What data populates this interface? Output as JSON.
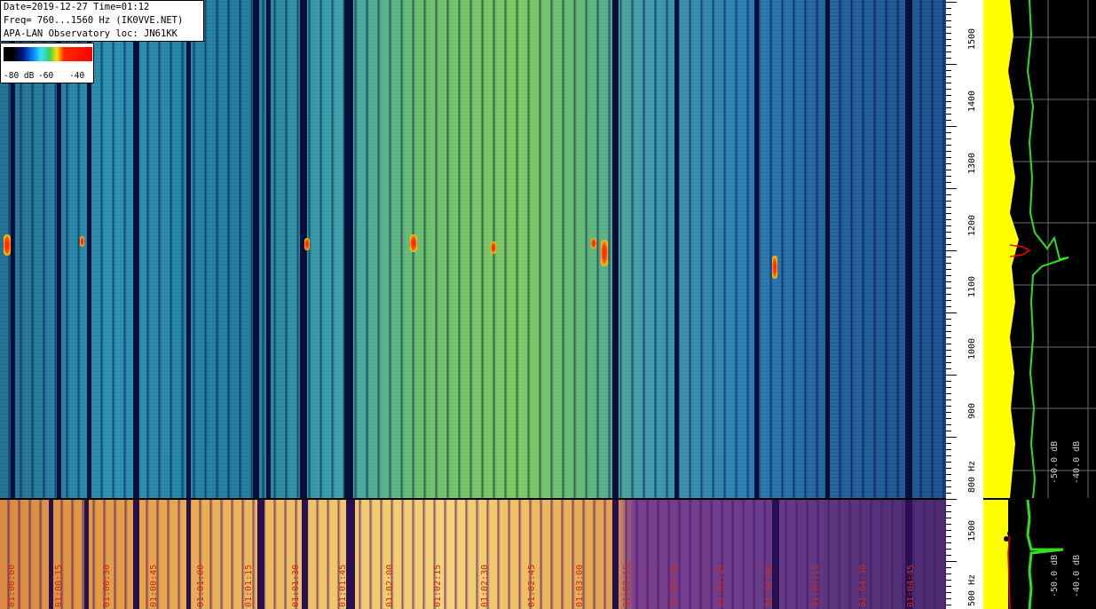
{
  "info": {
    "line1": "Date=2019-12-27 Time=01:12",
    "line2": "Freq= 760...1560 Hz (IK0VVE.NET)",
    "line3": "APA-LAN Observatory loc: JN61KK"
  },
  "colorbar": {
    "labels": [
      "-80 dB",
      "-60",
      "-40"
    ]
  },
  "freq_axis": {
    "ticks_upper": [
      "1500",
      "1400",
      "1300",
      "1200",
      "1100",
      "1000",
      "900",
      "800 Hz"
    ],
    "ticks_lower": [
      "1500",
      "500 Hz"
    ]
  },
  "spectrum": {
    "db_labels_upper": [
      "-50.0 dB",
      "-40.0 dB"
    ],
    "db_labels_lower": [
      "-50.0 dB",
      "-40.0 dB"
    ]
  },
  "time_labels": [
    "01:00:00",
    "01:00:15",
    "01:00:30",
    "01:00:45",
    "01:01:00",
    "01:01:15",
    "01:01:30",
    "01:01:45",
    "01:02:00",
    "01:02:15",
    "01:02:30",
    "01:02:45",
    "01:03:00",
    "01:03:15",
    "01:03:30",
    "01:03:45",
    "01:04:00",
    "01:04:15",
    "01:04:30",
    "01:04:45"
  ],
  "colors": {
    "background": "#000000",
    "signal": "#ff0000",
    "spectrum_fill": "#ffff00",
    "spectrum_peak": "#33dd22",
    "time_label": "#cc2b1a"
  }
}
